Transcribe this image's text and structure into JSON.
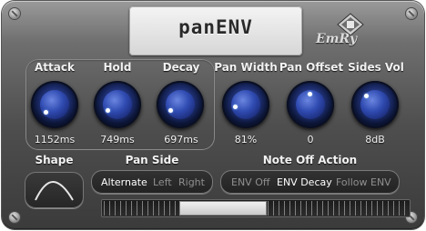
{
  "header": {
    "title": "panENV",
    "brand": "EmRy"
  },
  "knobs": [
    {
      "label": "Attack",
      "value": "1152ms"
    },
    {
      "label": "Hold",
      "value": "749ms"
    },
    {
      "label": "Decay",
      "value": "697ms"
    },
    {
      "label": "Pan Width",
      "value": "81%"
    },
    {
      "label": "Pan Offset",
      "value": "0"
    },
    {
      "label": "Sides Vol",
      "value": "8dB"
    }
  ],
  "shape": {
    "label": "Shape"
  },
  "pan_side": {
    "label": "Pan Side",
    "options": [
      "Alternate",
      "Left",
      "Right"
    ],
    "selected": "Alternate"
  },
  "note_off": {
    "label": "Note Off Action",
    "options": [
      "ENV Off",
      "ENV Decay",
      "Follow ENV"
    ],
    "selected": "ENV Decay"
  },
  "slider": {
    "position_fraction": 0.35
  },
  "colors": {
    "knob_blue": "#2f4ab0",
    "panel": "#4e4e4e",
    "title_panel": "#e6e6e6"
  }
}
